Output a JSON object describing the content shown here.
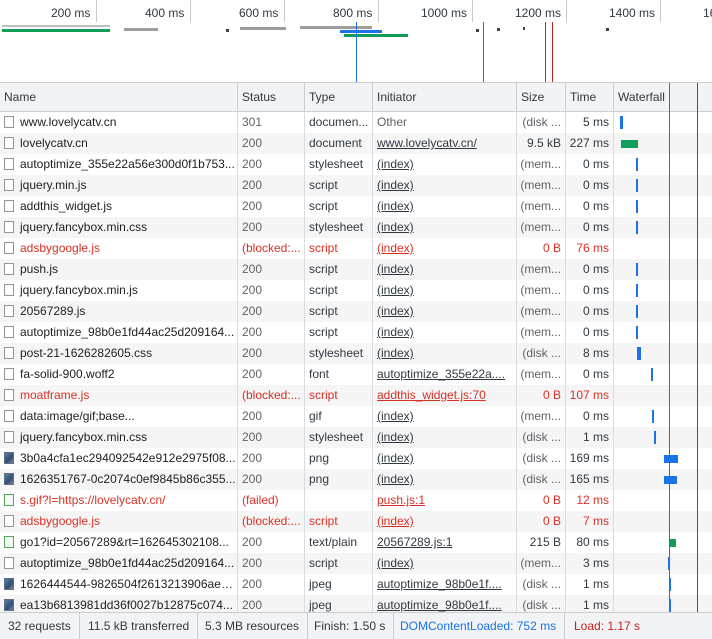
{
  "overview": {
    "ticks": [
      "200 ms",
      "400 ms",
      "600 ms",
      "800 ms",
      "1000 ms",
      "1200 ms",
      "1400 ms",
      "16"
    ]
  },
  "columns": {
    "name": "Name",
    "status": "Status",
    "type": "Type",
    "initiator": "Initiator",
    "size": "Size",
    "time": "Time",
    "waterfall": "Waterfall"
  },
  "requests": [
    {
      "name": "www.lovelycatv.cn",
      "status": "301",
      "type": "documen...",
      "initiator": "Other",
      "size": "(disk ...",
      "time": "5 ms",
      "icon": "document-icon",
      "init_style": "plain",
      "size_style": "ref",
      "err": false
    },
    {
      "name": "lovelycatv.cn",
      "status": "200",
      "type": "document",
      "initiator": "www.lovelycatv.cn/",
      "size": "9.5 kB",
      "time": "227 ms",
      "icon": "document-icon",
      "init_style": "link",
      "size_style": "plain",
      "err": false
    },
    {
      "name": "autoptimize_355e22a56e300d0f1b753...",
      "status": "200",
      "type": "stylesheet",
      "initiator": "(index)",
      "size": "(mem...",
      "time": "0 ms",
      "icon": "document-icon",
      "init_style": "link",
      "size_style": "ref",
      "err": false
    },
    {
      "name": "jquery.min.js",
      "status": "200",
      "type": "script",
      "initiator": "(index)",
      "size": "(mem...",
      "time": "0 ms",
      "icon": "document-icon",
      "init_style": "link",
      "size_style": "ref",
      "err": false
    },
    {
      "name": "addthis_widget.js",
      "status": "200",
      "type": "script",
      "initiator": "(index)",
      "size": "(mem...",
      "time": "0 ms",
      "icon": "document-icon",
      "init_style": "link",
      "size_style": "ref",
      "err": false
    },
    {
      "name": "jquery.fancybox.min.css",
      "status": "200",
      "type": "stylesheet",
      "initiator": "(index)",
      "size": "(mem...",
      "time": "0 ms",
      "icon": "document-icon",
      "init_style": "link",
      "size_style": "ref",
      "err": false
    },
    {
      "name": "adsbygoogle.js",
      "status": "(blocked:...",
      "type": "script",
      "initiator": "(index)",
      "size": "0 B",
      "time": "76 ms",
      "icon": "document-icon",
      "init_style": "link",
      "size_style": "plain",
      "err": true
    },
    {
      "name": "push.js",
      "status": "200",
      "type": "script",
      "initiator": "(index)",
      "size": "(mem...",
      "time": "0 ms",
      "icon": "document-icon",
      "init_style": "link",
      "size_style": "ref",
      "err": false
    },
    {
      "name": "jquery.fancybox.min.js",
      "status": "200",
      "type": "script",
      "initiator": "(index)",
      "size": "(mem...",
      "time": "0 ms",
      "icon": "document-icon",
      "init_style": "link",
      "size_style": "ref",
      "err": false
    },
    {
      "name": "20567289.js",
      "status": "200",
      "type": "script",
      "initiator": "(index)",
      "size": "(mem...",
      "time": "0 ms",
      "icon": "document-icon",
      "init_style": "link",
      "size_style": "ref",
      "err": false
    },
    {
      "name": "autoptimize_98b0e1fd44ac25d209164...",
      "status": "200",
      "type": "script",
      "initiator": "(index)",
      "size": "(mem...",
      "time": "0 ms",
      "icon": "document-icon",
      "init_style": "link",
      "size_style": "ref",
      "err": false
    },
    {
      "name": "post-21-1626282605.css",
      "status": "200",
      "type": "stylesheet",
      "initiator": "(index)",
      "size": "(disk ...",
      "time": "8 ms",
      "icon": "document-icon",
      "init_style": "link",
      "size_style": "ref",
      "err": false
    },
    {
      "name": "fa-solid-900.woff2",
      "status": "200",
      "type": "font",
      "initiator": "autoptimize_355e22a....",
      "size": "(mem...",
      "time": "0 ms",
      "icon": "document-icon",
      "init_style": "link",
      "size_style": "ref",
      "err": false
    },
    {
      "name": "moatframe.js",
      "status": "(blocked:...",
      "type": "script",
      "initiator": "addthis_widget.js:70",
      "size": "0 B",
      "time": "107 ms",
      "icon": "document-icon",
      "init_style": "link",
      "size_style": "plain",
      "err": true
    },
    {
      "name": "data:image/gif;base...",
      "status": "200",
      "type": "gif",
      "initiator": "(index)",
      "size": "(mem...",
      "time": "0 ms",
      "icon": "document-icon",
      "init_style": "link",
      "size_style": "ref",
      "err": false
    },
    {
      "name": "jquery.fancybox.min.css",
      "status": "200",
      "type": "stylesheet",
      "initiator": "(index)",
      "size": "(disk ...",
      "time": "1 ms",
      "icon": "document-icon",
      "init_style": "link",
      "size_style": "ref",
      "err": false
    },
    {
      "name": "3b0a4cfa1ec294092542e912e2975f08...",
      "status": "200",
      "type": "png",
      "initiator": "(index)",
      "size": "(disk ...",
      "time": "169 ms",
      "icon": "image-icon",
      "init_style": "link",
      "size_style": "ref",
      "err": false
    },
    {
      "name": "1626351767-0c2074c0ef9845b86c355...",
      "status": "200",
      "type": "png",
      "initiator": "(index)",
      "size": "(disk ...",
      "time": "165 ms",
      "icon": "image-icon",
      "init_style": "link",
      "size_style": "ref",
      "err": false
    },
    {
      "name": "s.gif?l=https://lovelycatv.cn/",
      "status": "(failed)",
      "type": "",
      "initiator": "push.js:1",
      "size": "0 B",
      "time": "12 ms",
      "icon": "gif-icon",
      "init_style": "link",
      "size_style": "plain",
      "err": true
    },
    {
      "name": "adsbygoogle.js",
      "status": "(blocked:...",
      "type": "script",
      "initiator": "(index)",
      "size": "0 B",
      "time": "7 ms",
      "icon": "document-icon",
      "init_style": "link",
      "size_style": "plain",
      "err": true
    },
    {
      "name": "go1?id=20567289&rt=162645302108...",
      "status": "200",
      "type": "text/plain",
      "initiator": "20567289.js:1",
      "size": "215 B",
      "time": "80 ms",
      "icon": "gif-icon",
      "init_style": "link",
      "size_style": "plain",
      "err": false
    },
    {
      "name": "autoptimize_98b0e1fd44ac25d209164...",
      "status": "200",
      "type": "script",
      "initiator": "(index)",
      "size": "(mem...",
      "time": "3 ms",
      "icon": "document-icon",
      "init_style": "link",
      "size_style": "ref",
      "err": false
    },
    {
      "name": "1626444544-9826504f2613213906ae6...",
      "status": "200",
      "type": "jpeg",
      "initiator": "autoptimize_98b0e1f....",
      "size": "(disk ...",
      "time": "1 ms",
      "icon": "image-icon",
      "init_style": "link",
      "size_style": "ref",
      "err": false
    },
    {
      "name": "ea13b6813981dd36f0027b12875c074...",
      "status": "200",
      "type": "jpeg",
      "initiator": "autoptimize_98b0e1f....",
      "size": "(disk ...",
      "time": "1 ms",
      "icon": "image-icon",
      "init_style": "link",
      "size_style": "ref",
      "err": false
    }
  ],
  "status_bar": {
    "requests": "32 requests",
    "transferred": "11.5 kB transferred",
    "resources": "5.3 MB resources",
    "finish": "Finish: 1.50 s",
    "dcl": "DOMContentLoaded: 752 ms",
    "load": "Load: 1.17 s"
  },
  "colors": {
    "dcl_line": "#1a73e8",
    "load_line": "#c5221f",
    "bar_blue": "#1a73e8",
    "bar_green": "#0f9d58",
    "error_text": "#d93025"
  }
}
